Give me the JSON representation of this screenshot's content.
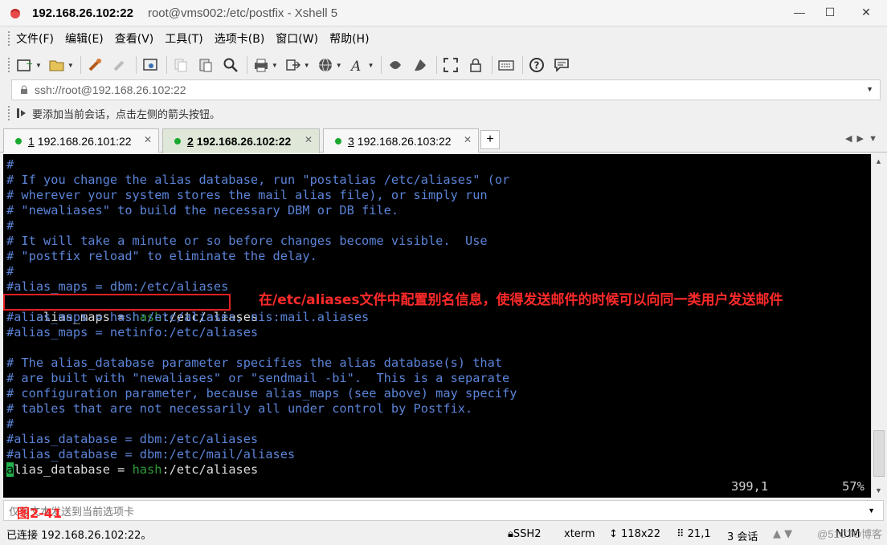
{
  "window": {
    "title_ip": "192.168.26.102:22",
    "title_rest": "root@vms002:/etc/postfix - Xshell 5",
    "controls": [
      "minimize",
      "maximize",
      "close"
    ]
  },
  "menu": [
    "文件(F)",
    "编辑(E)",
    "查看(V)",
    "工具(T)",
    "选项卡(B)",
    "窗口(W)",
    "帮助(H)"
  ],
  "address": {
    "value": "ssh://root@192.168.26.102:22"
  },
  "hint": "要添加当前会话，点击左侧的箭头按钮。",
  "tabs": [
    {
      "num": "1",
      "label": "192.168.26.101:22",
      "active": false
    },
    {
      "num": "2",
      "label": "192.168.26.102:22",
      "active": true
    },
    {
      "num": "3",
      "label": "192.168.26.103:22",
      "active": false
    }
  ],
  "terminal": {
    "lines": [
      "#",
      "# If you change the alias database, run \"postalias /etc/aliases\" (or",
      "# wherever your system stores the mail alias file), or simply run",
      "# \"newaliases\" to build the necessary DBM or DB file.",
      "#",
      "# It will take a minute or so before changes become visible.  Use",
      "# \"postfix reload\" to eliminate the delay.",
      "#",
      "#alias_maps = dbm:/etc/aliases",
      "",
      "#alias_maps = hash:/etc/aliases, nis:mail.aliases",
      "#alias_maps = netinfo:/etc/aliases",
      "",
      "# The alias_database parameter specifies the alias database(s) that",
      "# are built with \"newaliases\" or \"sendmail -bi\".  This is a separate",
      "# configuration parameter, because alias_maps (see above) may specify",
      "# tables that are not necessarily all under control by Postfix.",
      "#",
      "#alias_database = dbm:/etc/aliases",
      "#alias_database = dbm:/etc/mail/aliases"
    ],
    "alias_maps_line": {
      "key": "alias_maps",
      "eq": " = ",
      "type": "hash",
      "path": ":/etc/aliases"
    },
    "alias_db_line": {
      "cursor": "a",
      "key": "lias_database",
      "eq": " = ",
      "type": "hash",
      "path": ":/etc/aliases"
    },
    "position": "399,1",
    "percent": "57%"
  },
  "annotation": "在/etc/aliases文件中配置别名信息，使得发送邮件的时候可以向同一类用户发送邮件",
  "figure_label": "图2-41",
  "input_placeholder": "仅将文本发送到当前选项卡",
  "status": {
    "connection": "已连接 192.168.26.102:22。",
    "protocol": "SSH2",
    "term": "xterm",
    "size": "118x22",
    "cursor": "21,1",
    "sessions": "3 会话",
    "num": "NUM"
  },
  "watermark": "@51CTO博客"
}
